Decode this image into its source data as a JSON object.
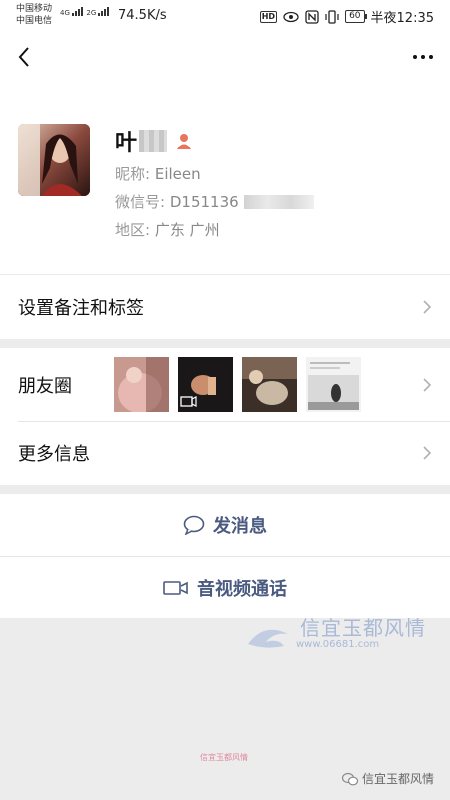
{
  "status_bar": {
    "carrier1": "中国移动",
    "carrier2": "中国电信",
    "net1": "4G",
    "net2": "2G",
    "speed": "74.5K/s",
    "hd": "HD",
    "battery": "60",
    "time": "半夜12:35"
  },
  "profile": {
    "name": "叶",
    "nickname_label": "昵称:",
    "nickname": "Eileen",
    "wechat_id_label": "微信号:",
    "wechat_id": "D151136",
    "region_label": "地区:",
    "region": "广东  广州",
    "gender_icon": "female-icon"
  },
  "menu": {
    "remark": "设置备注和标签",
    "moments": "朋友圈",
    "more_info": "更多信息"
  },
  "actions": {
    "send_message": "发消息",
    "video_call": "音视频通话"
  },
  "watermarks": {
    "brand": "信宜玉都风情",
    "url": "www.06681.com",
    "small": "信宜玉都风情",
    "corner": "信宜玉都风情"
  },
  "colors": {
    "action_text": "#4a5a80",
    "background": "#ececec",
    "gender_icon": "#e8765d"
  }
}
